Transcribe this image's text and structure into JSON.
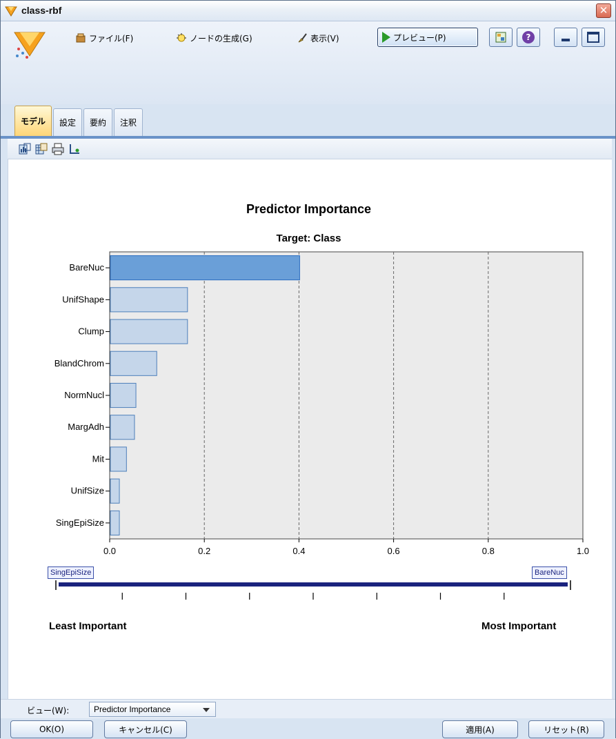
{
  "window": {
    "title": "class-rbf",
    "close_symbol": "✕"
  },
  "menu": {
    "file": "ファイル(F)",
    "generate": "ノードの生成(G)",
    "view": "表示(V)",
    "preview": "プレビュー(P)"
  },
  "toolbar": {
    "help_symbol": "?"
  },
  "tabs": [
    {
      "label": "モデル",
      "active": true
    },
    {
      "label": "設定",
      "active": false
    },
    {
      "label": "要約",
      "active": false
    },
    {
      "label": "注釈",
      "active": false
    }
  ],
  "chart_data": {
    "type": "bar",
    "orientation": "horizontal",
    "title": "Predictor Importance",
    "subtitle": "Target: Class",
    "categories": [
      "BareNuc",
      "UnifShape",
      "Clump",
      "BlandChrom",
      "NormNucl",
      "MargAdh",
      "Mit",
      "UnifSize",
      "SingEpiSize"
    ],
    "values": [
      0.4,
      0.163,
      0.163,
      0.098,
      0.054,
      0.051,
      0.034,
      0.019,
      0.019
    ],
    "highlighted": "BareNuc",
    "xlim": [
      0.0,
      1.0
    ],
    "xticks": [
      "0.0",
      "0.2",
      "0.4",
      "0.6",
      "0.8",
      "1.0"
    ],
    "grid": "vertical dashed",
    "bar_color": "#c5d6ea",
    "highlight_color": "#6a9fd8",
    "plot_background": "#ebebeb"
  },
  "importance_slider": {
    "left_label": "SingEpiSize",
    "right_label": "BareNuc",
    "least_text": "Least Important",
    "most_text": "Most Important"
  },
  "view_selector": {
    "label": "ビュー(W):",
    "value": "Predictor Importance"
  },
  "buttons": {
    "ok": "OK(O)",
    "cancel": "キャンセル(C)",
    "apply": "適用(A)",
    "reset": "リセット(R)"
  }
}
